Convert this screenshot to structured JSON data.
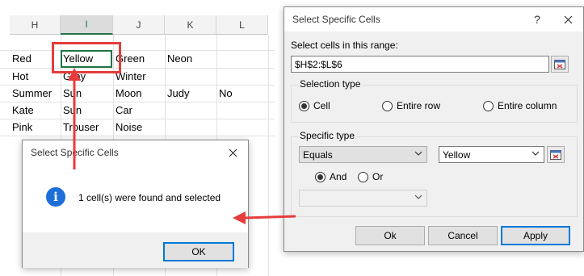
{
  "sheet": {
    "columns": [
      "H",
      "I",
      "J",
      "K",
      "L"
    ],
    "rows": [
      [
        "Red",
        "Yellow",
        "Green",
        "Neon",
        ""
      ],
      [
        "Hot",
        "Gray",
        "Winter",
        "",
        ""
      ],
      [
        "Summer",
        "Sun",
        "Moon",
        "Judy",
        "No"
      ],
      [
        "Kate",
        "Sun",
        "Car",
        "",
        ""
      ],
      [
        "Pink",
        "Trouser",
        "Noise",
        "",
        ""
      ]
    ]
  },
  "result_dialog": {
    "title": "Select Specific Cells",
    "message": "1 cell(s) were found and selected",
    "ok_label": "OK",
    "icon": "info-icon"
  },
  "main_dialog": {
    "title": "Select Specific Cells",
    "help_label": "?",
    "close_label": "✕",
    "range_label": "Select cells in this range:",
    "range_value": "$H$2:$L$6",
    "selection_type_label": "Selection type",
    "selection_options": [
      "Cell",
      "Entire row",
      "Entire column"
    ],
    "selection_selected": "Cell",
    "specific_type_label": "Specific type",
    "condition1": "Equals",
    "value1": "Yellow",
    "logic_options": [
      "And",
      "Or"
    ],
    "logic_selected": "And",
    "condition2": "",
    "ok_label": "Ok",
    "cancel_label": "Cancel",
    "apply_label": "Apply"
  },
  "colors": {
    "highlight_box": "#e63c3c",
    "arrow": "#e63c3c",
    "accent": "#0078d7",
    "info_icon": "#1e6fd9"
  }
}
